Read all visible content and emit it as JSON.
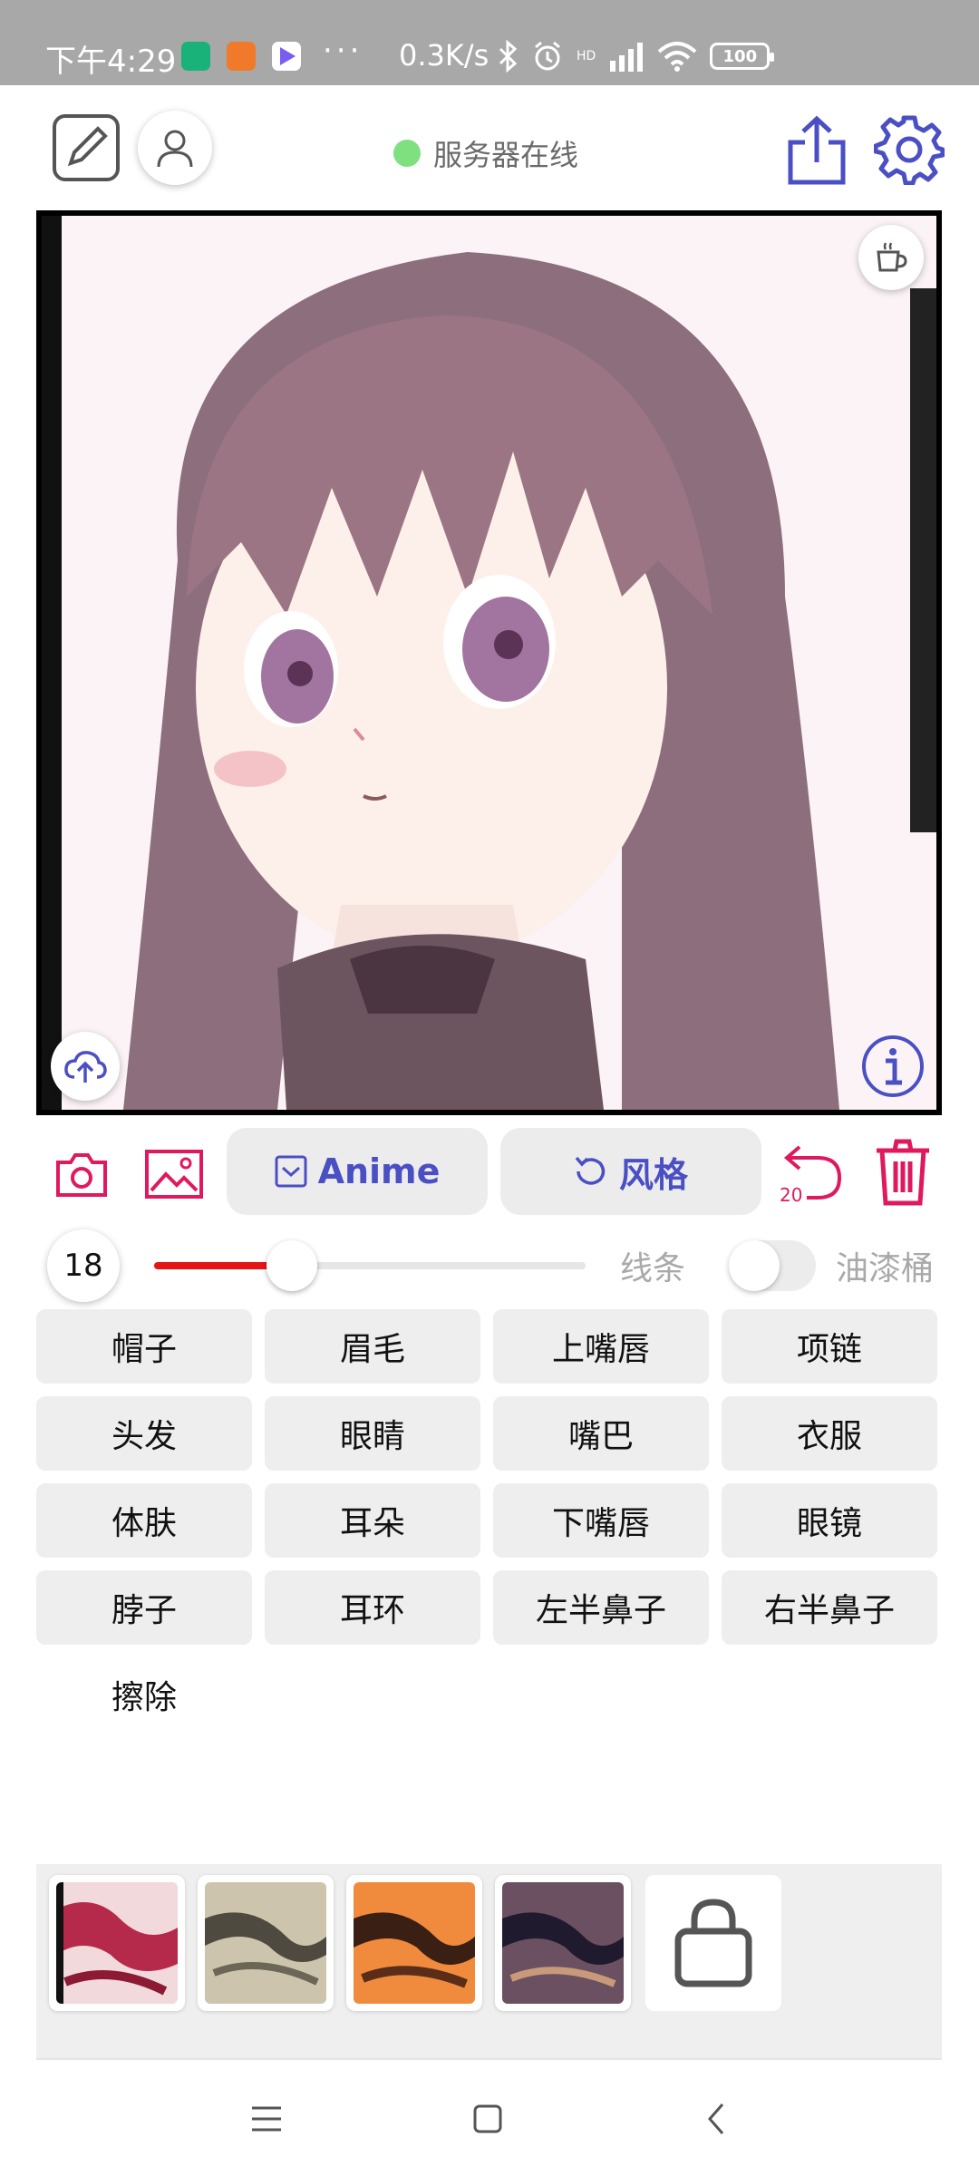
{
  "status_bar": {
    "time": "下午4:29",
    "dots": "···",
    "net_speed": "0.3K/s",
    "network_label": "HD",
    "battery": "100"
  },
  "toolbar": {
    "server_status": "服务器在线"
  },
  "actions": {
    "anime_label": "Anime",
    "style_label": "风格",
    "undo_count": "20"
  },
  "brush": {
    "size": "18",
    "size_fraction": 0.32,
    "line_label": "线条",
    "bucket_label": "油漆桶",
    "bucket_enabled": false
  },
  "parts": [
    {
      "label": "帽子"
    },
    {
      "label": "眉毛"
    },
    {
      "label": "上嘴唇"
    },
    {
      "label": "项链"
    },
    {
      "label": "头发"
    },
    {
      "label": "眼睛"
    },
    {
      "label": "嘴巴"
    },
    {
      "label": "衣服"
    },
    {
      "label": "体肤"
    },
    {
      "label": "耳朵"
    },
    {
      "label": "下嘴唇"
    },
    {
      "label": "眼镜"
    },
    {
      "label": "脖子"
    },
    {
      "label": "耳环"
    },
    {
      "label": "左半鼻子"
    },
    {
      "label": "右半鼻子"
    },
    {
      "label": "擦除"
    }
  ],
  "style_thumbnails": [
    {
      "name": "pink-white"
    },
    {
      "name": "beige-gray"
    },
    {
      "name": "orange-dark"
    },
    {
      "name": "brown-purple"
    }
  ],
  "colors": {
    "accent_red": "#e0195f",
    "accent_blue": "#4b4fc4",
    "server_online": "#7ee07e",
    "slider_fill": "#e61515"
  }
}
